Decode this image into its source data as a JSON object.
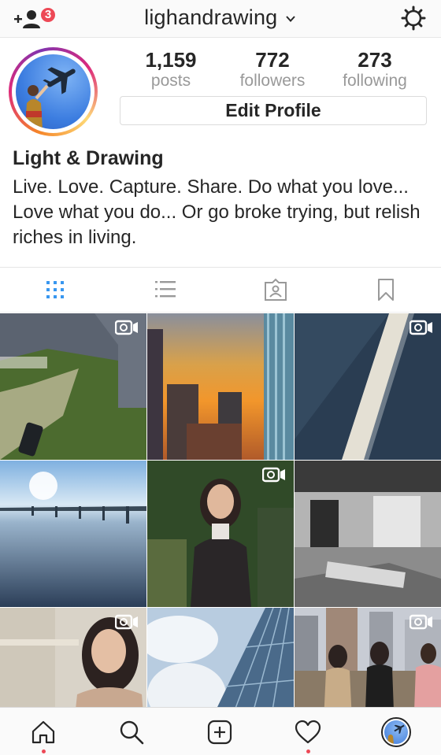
{
  "header": {
    "username": "lighandrawing",
    "notification_count": "3",
    "icons": [
      "add-user-icon",
      "chevron-down-icon",
      "settings-gear-icon"
    ]
  },
  "profile": {
    "posts_count": "1,159",
    "posts_label": "posts",
    "followers_count": "772",
    "followers_label": "followers",
    "following_count": "273",
    "following_label": "following",
    "edit_button": "Edit Profile",
    "display_name": "Light & Drawing",
    "bio": "Live. Love. Capture. Share. Do what you love... Love what you do... Or go broke trying, but relish riches in living."
  },
  "tabs": {
    "active": "grid",
    "items": [
      "grid-view-icon",
      "list-view-icon",
      "tagged-photos-icon",
      "saved-bookmark-icon"
    ]
  },
  "grid": {
    "posts": [
      {
        "name": "aerial-house-lawn",
        "video": true
      },
      {
        "name": "city-sunset-skyline",
        "video": false
      },
      {
        "name": "aerial-pier-water",
        "video": true
      },
      {
        "name": "bridge-sunrise",
        "video": false
      },
      {
        "name": "woman-in-forest",
        "video": true
      },
      {
        "name": "office-interior",
        "video": false
      },
      {
        "name": "woman-portrait-room",
        "video": true
      },
      {
        "name": "glass-tower-sky",
        "video": false
      },
      {
        "name": "group-rooftop",
        "video": true
      }
    ]
  },
  "bottom_nav": {
    "items": [
      "home-icon",
      "search-icon",
      "new-post-icon",
      "activity-heart-icon",
      "profile-avatar"
    ],
    "active": "profile-avatar",
    "accent": "#ed4956"
  },
  "colors": {
    "text": "#262626",
    "muted": "#999999",
    "active_tab": "#3897f0",
    "notification": "#ed4956"
  }
}
